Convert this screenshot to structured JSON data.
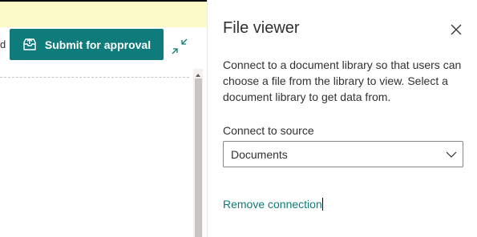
{
  "toolbar": {
    "clipped_text": "d",
    "submit_label": "Submit for approval"
  },
  "panel": {
    "title": "File viewer",
    "description": "Connect to a document library so that users can choose a file from the library to view. Select a document library to get data from.",
    "source_label": "Connect to source",
    "source_value": "Documents",
    "remove_link": "Remove connection"
  },
  "colors": {
    "accent": "#0f7b7b",
    "banner": "#fcfac6"
  },
  "icons": {
    "submit": "approval-send-icon",
    "collapse": "collapse-arrows-icon",
    "close": "close-icon",
    "dropdown": "chevron-down-icon"
  }
}
